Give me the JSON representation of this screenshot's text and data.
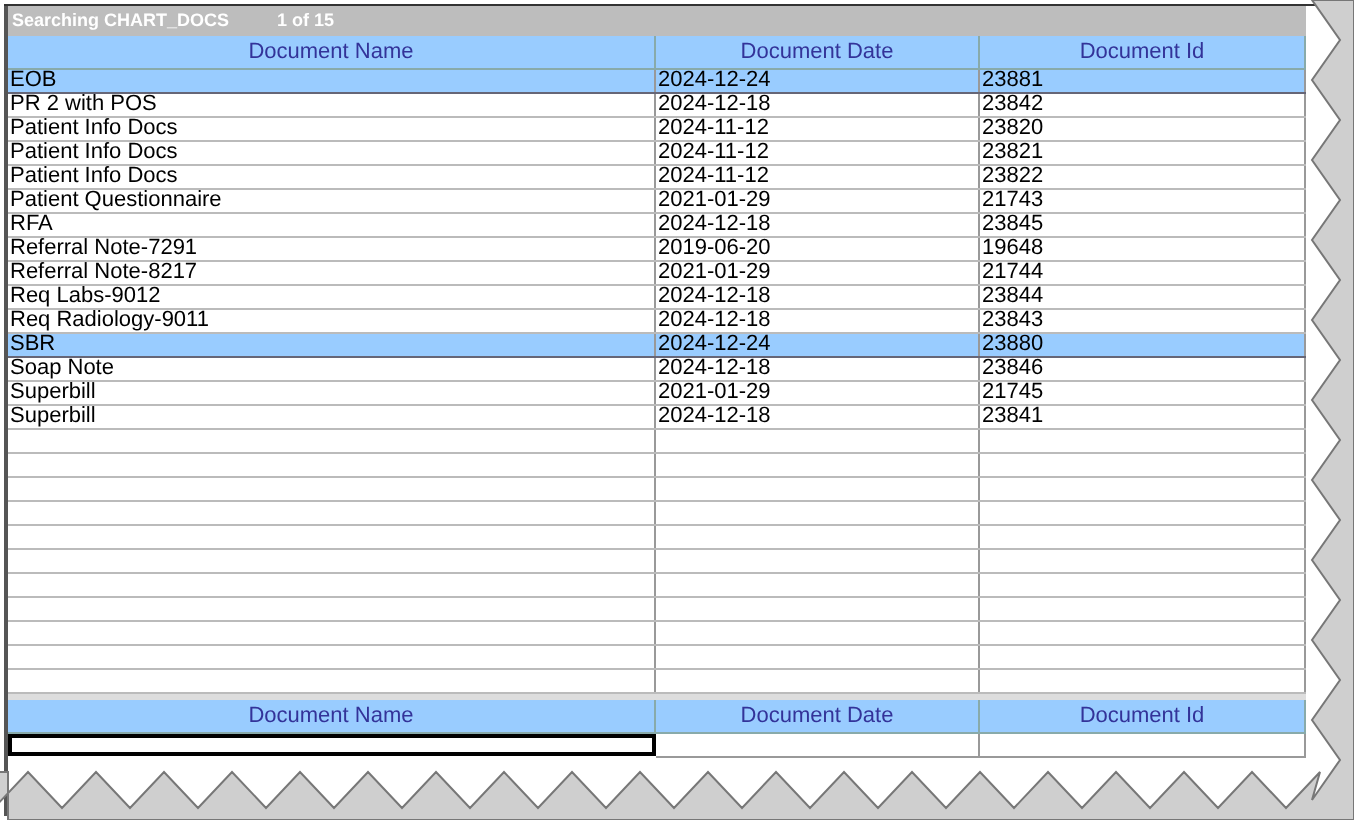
{
  "title_bar": {
    "title": "Searching CHART_DOCS",
    "count": "1 of 15"
  },
  "table": {
    "columns": [
      "Document Name",
      "Document Date",
      "Document Id"
    ],
    "rows": [
      {
        "cells": [
          "EOB",
          "2024-12-24",
          "23881"
        ],
        "selected": true
      },
      {
        "cells": [
          "PR 2 with POS",
          "2024-12-18",
          "23842"
        ],
        "selected": false
      },
      {
        "cells": [
          "Patient Info Docs",
          "2024-11-12",
          "23820"
        ],
        "selected": false
      },
      {
        "cells": [
          "Patient Info Docs",
          "2024-11-12",
          "23821"
        ],
        "selected": false
      },
      {
        "cells": [
          "Patient Info Docs",
          "2024-11-12",
          "23822"
        ],
        "selected": false
      },
      {
        "cells": [
          "Patient Questionnaire",
          "2021-01-29",
          "21743"
        ],
        "selected": false
      },
      {
        "cells": [
          "RFA",
          "2024-12-18",
          "23845"
        ],
        "selected": false
      },
      {
        "cells": [
          "Referral Note-7291",
          "2019-06-20",
          "19648"
        ],
        "selected": false
      },
      {
        "cells": [
          "Referral Note-8217",
          "2021-01-29",
          "21744"
        ],
        "selected": false
      },
      {
        "cells": [
          "Req Labs-9012",
          "2024-12-18",
          "23844"
        ],
        "selected": false
      },
      {
        "cells": [
          "Req Radiology-9011",
          "2024-12-18",
          "23843"
        ],
        "selected": false
      },
      {
        "cells": [
          "SBR",
          "2024-12-24",
          "23880"
        ],
        "selected": true
      },
      {
        "cells": [
          "Soap Note",
          "2024-12-18",
          "23846"
        ],
        "selected": false
      },
      {
        "cells": [
          "Superbill",
          "2021-01-29",
          "21745"
        ],
        "selected": false
      },
      {
        "cells": [
          "Superbill",
          "2024-12-18",
          "23841"
        ],
        "selected": false
      }
    ]
  },
  "filter_row": {
    "columns": [
      "Document Name",
      "Document Date",
      "Document Id"
    ]
  }
}
